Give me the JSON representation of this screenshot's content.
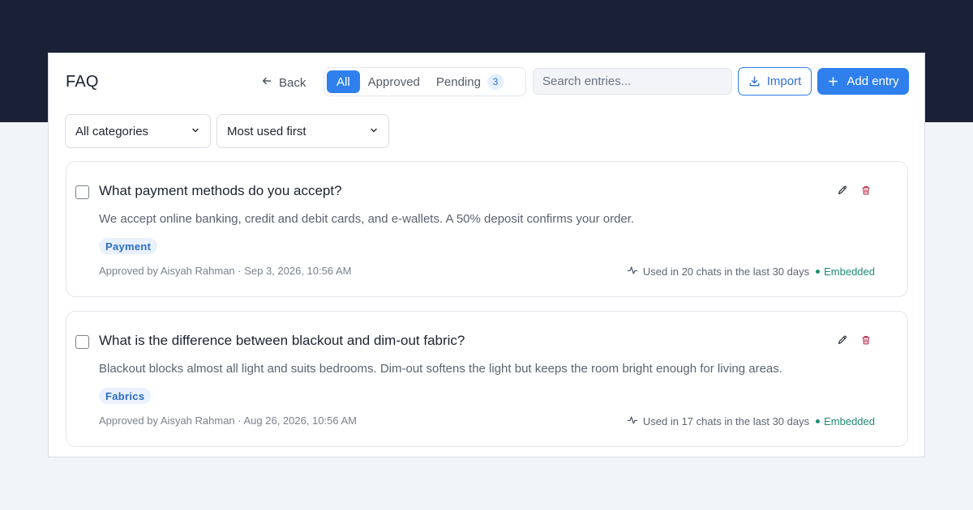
{
  "header": {
    "title": "FAQ",
    "back_label": "Back",
    "tabs": [
      {
        "label": "All",
        "active": true
      },
      {
        "label": "Approved",
        "active": false
      },
      {
        "label": "Pending",
        "count": "3",
        "active": false
      }
    ],
    "search_placeholder": "Search entries...",
    "import_label": "Import",
    "add_label": "Add entry"
  },
  "filters": {
    "category": "All categories",
    "sort": "Most used first"
  },
  "entries": [
    {
      "question": "What payment methods do you accept?",
      "answer": "We accept online banking, credit and debit cards, and e-wallets. A 50% deposit confirms your order.",
      "tag": "Payment",
      "meta": "Approved by Aisyah Rahman · Sep 3, 2026, 10:56 AM",
      "usage": "Used in 20 chats in the last 30 days",
      "status": "Embedded"
    },
    {
      "question": "What is the difference between blackout and dim-out fabric?",
      "answer": "Blackout blocks almost all light and suits bedrooms. Dim-out softens the light but keeps the room bright enough for living areas.",
      "tag": "Fabrics",
      "meta": "Approved by Aisyah Rahman · Aug 26, 2026, 10:56 AM",
      "usage": "Used in 17 chats in the last 30 days",
      "status": "Embedded"
    }
  ],
  "colors": {
    "accent": "#2f80ed",
    "header_band": "#1a2035",
    "background": "#f1f4f9",
    "embedded": "#1d8c74",
    "delete": "#c0304f"
  },
  "icons": {
    "back": "arrow-left-icon",
    "import": "download-icon",
    "add": "plus-icon",
    "dropdown": "chevron-down-icon",
    "edit": "pencil-icon",
    "delete": "trash-icon",
    "usage": "activity-icon"
  }
}
